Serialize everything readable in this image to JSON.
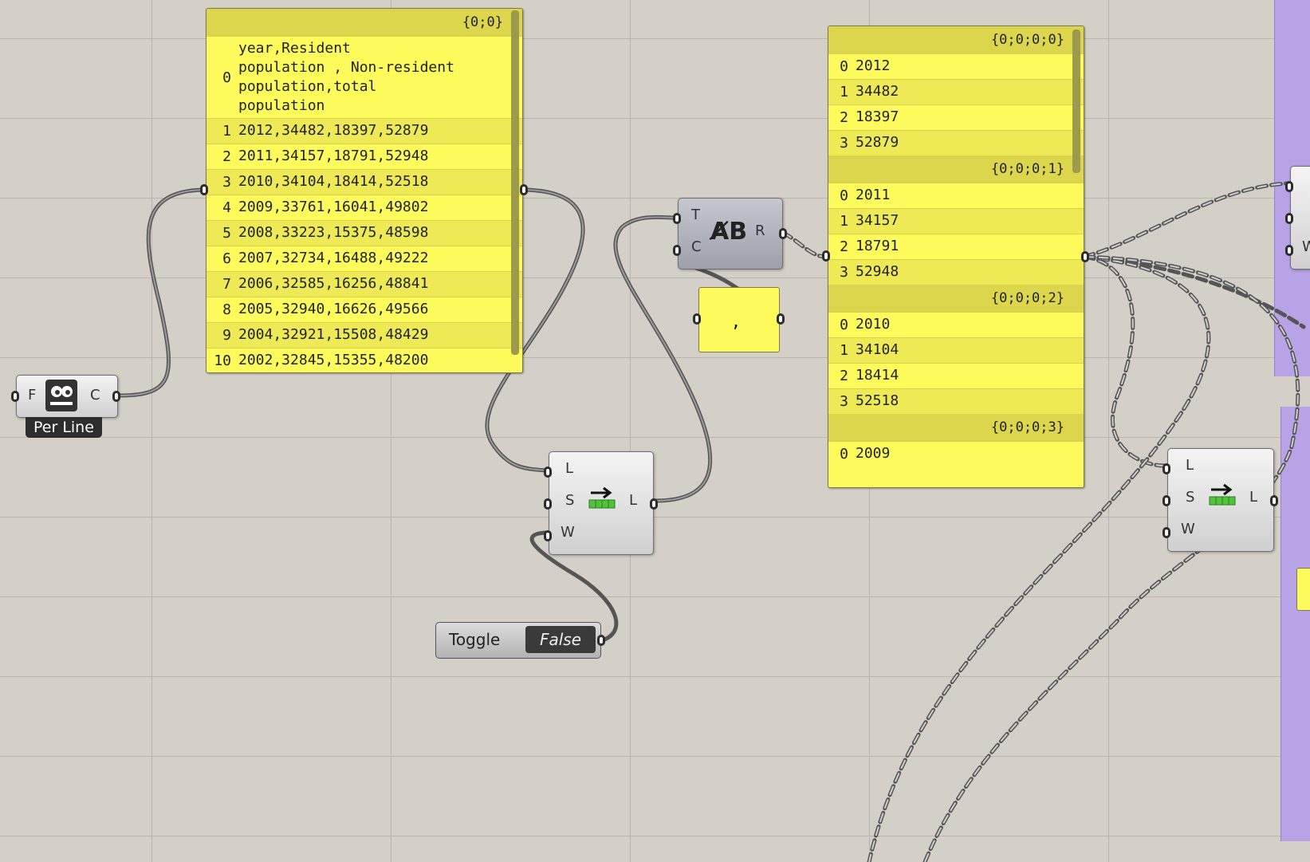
{
  "reader": {
    "input_label": "F",
    "output_label": "C",
    "mode_tag": "Per Line",
    "icon": "file-reader-icon"
  },
  "data_panel": {
    "path": "{0;0}",
    "rows": [
      {
        "i": "0",
        "v": "year,Resident\npopulation , Non-resident\npopulation,total\npopulation"
      },
      {
        "i": "1",
        "v": "2012,34482,18397,52879"
      },
      {
        "i": "2",
        "v": "2011,34157,18791,52948"
      },
      {
        "i": "3",
        "v": "2010,34104,18414,52518"
      },
      {
        "i": "4",
        "v": "2009,33761,16041,49802"
      },
      {
        "i": "5",
        "v": "2008,33223,15375,48598"
      },
      {
        "i": "6",
        "v": "2007,32734,16488,49222"
      },
      {
        "i": "7",
        "v": "2006,32585,16256,48841"
      },
      {
        "i": "8",
        "v": "2005,32940,16626,49566"
      },
      {
        "i": "9",
        "v": "2004,32921,15508,48429"
      },
      {
        "i": "10",
        "v": "2002,32845,15355,48200"
      }
    ]
  },
  "split_text": {
    "input_t": "T",
    "input_c": "C",
    "output_r": "R",
    "icon": "text-split-icon"
  },
  "separator_panel": {
    "value": ","
  },
  "shift_list_1": {
    "input_l": "L",
    "input_s": "S",
    "input_w": "W",
    "output_l": "L",
    "icon": "shift-list-icon"
  },
  "shift_list_2": {
    "input_l": "L",
    "input_s": "S",
    "input_w": "W",
    "output_l": "L",
    "icon": "shift-list-icon"
  },
  "toggle": {
    "label": "Toggle",
    "value": "False"
  },
  "result_panel": {
    "groups": [
      {
        "path": "{0;0;0;0}",
        "items": [
          {
            "i": "0",
            "v": "2012"
          },
          {
            "i": "1",
            "v": "34482"
          },
          {
            "i": "2",
            "v": "18397"
          },
          {
            "i": "3",
            "v": "52879"
          }
        ]
      },
      {
        "path": "{0;0;0;1}",
        "items": [
          {
            "i": "0",
            "v": "2011"
          },
          {
            "i": "1",
            "v": "34157"
          },
          {
            "i": "2",
            "v": "18791"
          },
          {
            "i": "3",
            "v": "52948"
          }
        ]
      },
      {
        "path": "{0;0;0;2}",
        "items": [
          {
            "i": "0",
            "v": "2010"
          },
          {
            "i": "1",
            "v": "34104"
          },
          {
            "i": "2",
            "v": "18414"
          },
          {
            "i": "3",
            "v": "52518"
          }
        ]
      },
      {
        "path": "{0;0;0;3}",
        "items": [
          {
            "i": "0",
            "v": "2009"
          }
        ]
      }
    ]
  },
  "partial_component": {
    "input_w": "W"
  },
  "colors": {
    "panel": "#fdfa5b",
    "panel_header": "#dbd64c",
    "group": "#b7a3e6",
    "canvas": "#d4d0c8"
  }
}
